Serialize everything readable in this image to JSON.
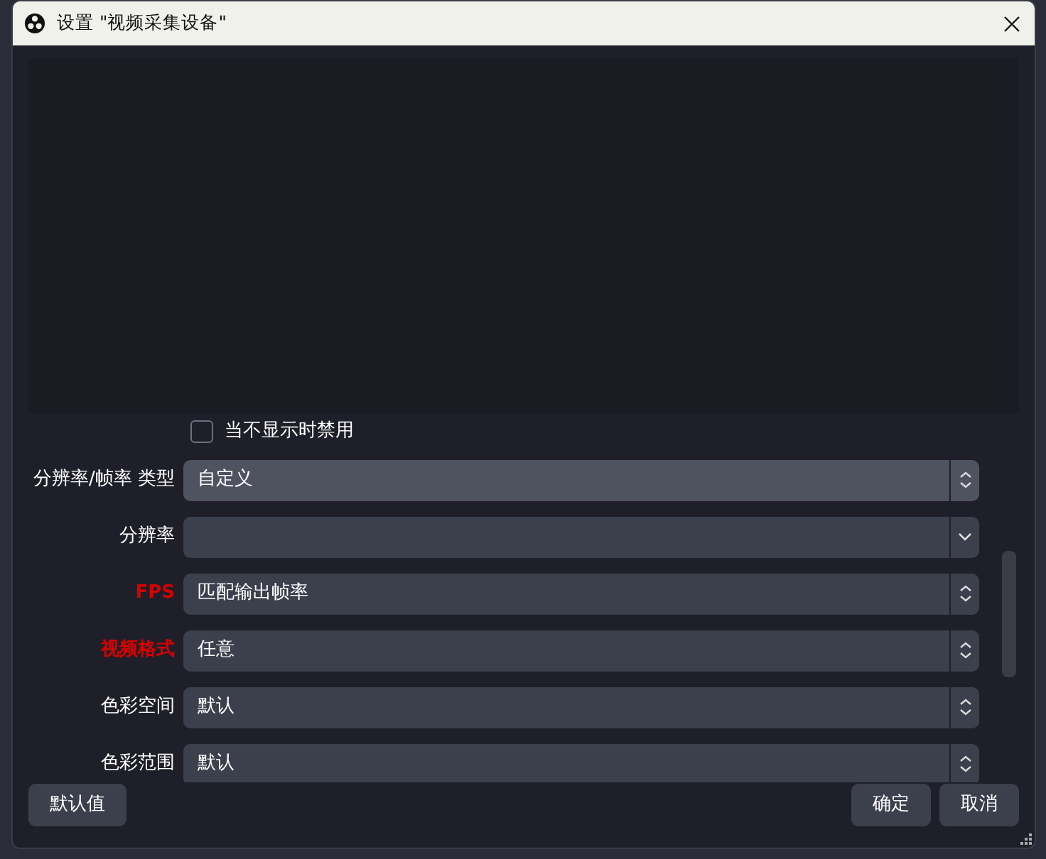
{
  "window": {
    "title": "设置 \"视频采集设备\""
  },
  "checkbox": {
    "label": "当不显示时禁用",
    "checked": false
  },
  "fields": [
    {
      "label": "分辨率/帧率 类型",
      "value": "自定义",
      "kind": "spin",
      "warning": false,
      "focused": true
    },
    {
      "label": "分辨率",
      "kind": "dropdown",
      "warning": false,
      "focused": false
    },
    {
      "label": "FPS",
      "value": "匹配输出帧率",
      "kind": "spin",
      "warning": true,
      "focused": false
    },
    {
      "label": "视频格式",
      "value": "任意",
      "kind": "spin",
      "warning": true,
      "focused": false
    },
    {
      "label": "色彩空间",
      "value": "默认",
      "kind": "spin",
      "warning": false,
      "focused": false
    },
    {
      "label": "色彩范围",
      "value": "默认",
      "kind": "spin",
      "warning": false,
      "focused": false
    }
  ],
  "buttons_left": [
    "默认值"
  ],
  "buttons_right": [
    "确定",
    "取消"
  ]
}
